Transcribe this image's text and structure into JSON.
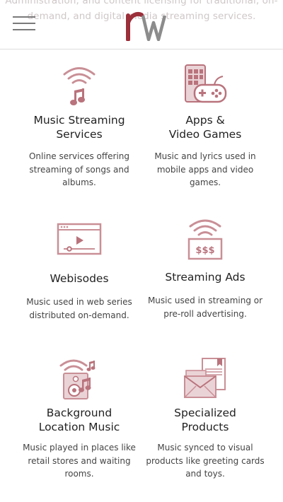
{
  "background_text": "Administration, and content licensing for traditional, on-demand, and digital media streaming services.",
  "header": {
    "logo_text": "rw",
    "menu_icon": "hamburger-menu-icon"
  },
  "colors": {
    "accent_red": "#9b2f3a",
    "accent_gray": "#8c8c8c",
    "icon_rose": "#c98f96",
    "icon_fill": "#ead3d6"
  },
  "services": [
    {
      "title_line1": "Music Streaming",
      "title_line2": "Services",
      "desc": "Online services offering streaming of songs and albums.",
      "icon": "wifi-music-note-icon"
    },
    {
      "title_line1": "Apps &",
      "title_line2": "Video Games",
      "desc": "Music and lyrics used in mobile apps and video games.",
      "icon": "phone-gamepad-icon"
    },
    {
      "title_line1": "Webisodes",
      "title_line2": "",
      "desc": "Music used in web series distributed on-demand.",
      "icon": "video-player-icon"
    },
    {
      "title_line1": "Streaming Ads",
      "title_line2": "",
      "desc": "Music used in streaming or pre-roll advertising.",
      "icon": "wifi-dollar-sign-icon"
    },
    {
      "title_line1": "Background",
      "title_line2": "Location Music",
      "desc": "Music played in places like retail stores and waiting rooms.",
      "icon": "speaker-music-icon"
    },
    {
      "title_line1": "Specialized",
      "title_line2": "Products",
      "desc": "Music synced to visual products like greeting cards and toys.",
      "icon": "greeting-card-envelope-icon"
    }
  ]
}
